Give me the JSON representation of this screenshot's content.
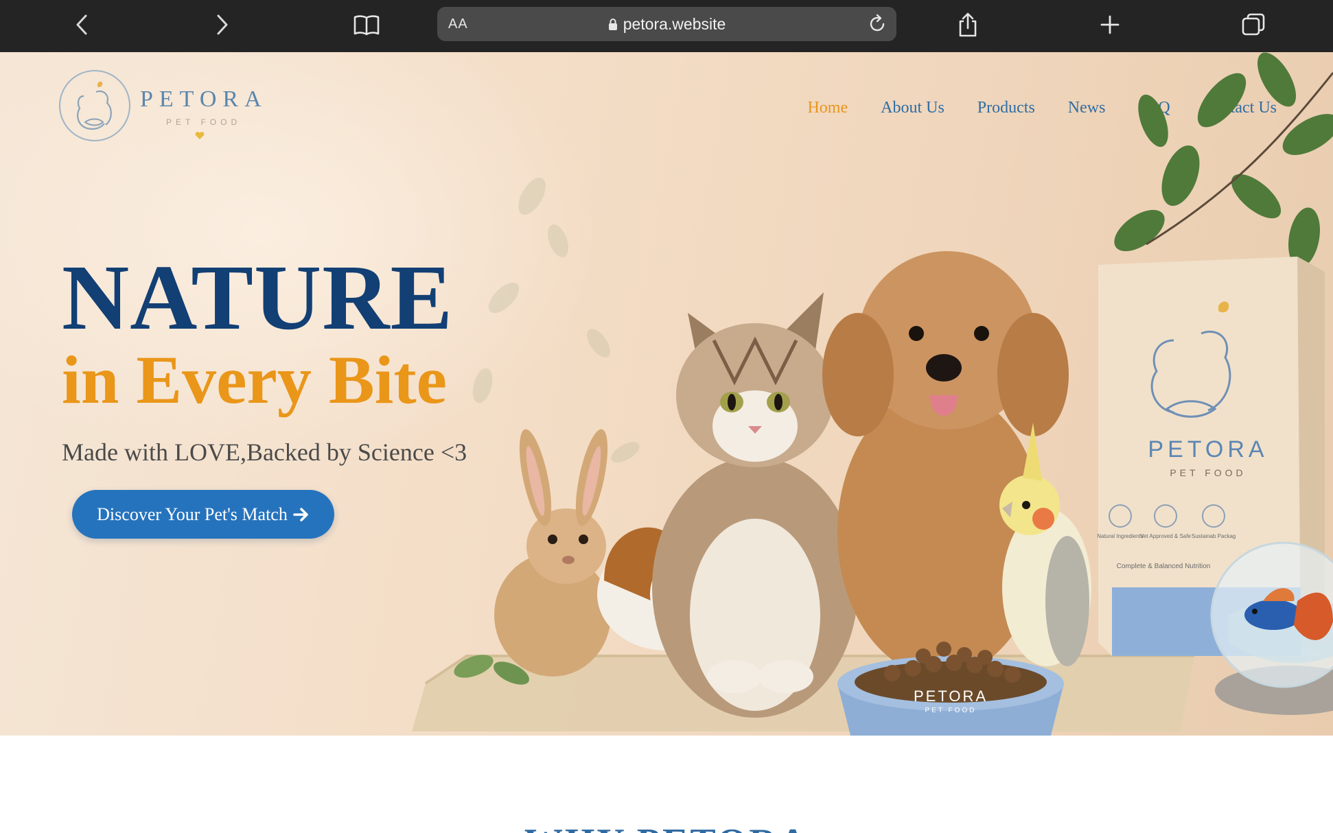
{
  "browser": {
    "url_aa_label": "AA",
    "url": "petora.website",
    "icons": [
      "back-arrow-icon",
      "forward-arrow-icon",
      "bookmarks-book-icon",
      "lock-icon",
      "reload-icon",
      "share-icon",
      "new-tab-plus-icon",
      "tabs-overview-icon"
    ]
  },
  "site": {
    "logo": {
      "word": "PETORA",
      "sub": "PET FOOD"
    },
    "nav": [
      {
        "label": "Home",
        "active": true
      },
      {
        "label": "About Us"
      },
      {
        "label": "Products"
      },
      {
        "label": "News"
      },
      {
        "label": "FAQ"
      },
      {
        "label": "Contact Us"
      }
    ],
    "hero": {
      "headline_1": "NATURE",
      "headline_2": "in Every Bite",
      "tagline": "Made with LOVE,Backed by Science <3",
      "cta_label": "Discover Your Pet's Match",
      "bag_brand": "PETORA",
      "bag_sub": "PET FOOD",
      "bag_features": [
        "Natural Ingredients",
        "Vet Approved & Safe",
        "Sustainab Packag"
      ],
      "bag_footer": "Complete & Balanced Nutrition",
      "bowl_brand": "PETORA",
      "bowl_sub": "PET FOOD"
    },
    "next_section_title": "WHY PETORA"
  },
  "colors": {
    "navy": "#123f74",
    "orange": "#e99619",
    "link_blue": "#2e6da3",
    "cta_blue": "#2673bd",
    "toolbar": "#242424"
  }
}
